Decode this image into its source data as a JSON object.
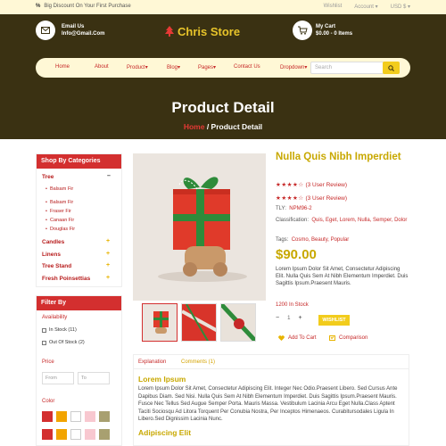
{
  "topbar": {
    "promo": "Big Discount On Your First Purchase",
    "links": [
      "Wishlist",
      "Account",
      "USD $"
    ]
  },
  "header": {
    "email_label": "Email Us",
    "email_value": "Info@Gmail.Com",
    "logo": "Chris Store",
    "cart_label": "My Cart",
    "cart_value": "$0.00 - 0 Items"
  },
  "nav": {
    "items": [
      "Home",
      "About",
      "Product",
      "Blog",
      "Pages",
      "Contact Us",
      "Dropdown"
    ],
    "dropdown_flags": [
      false,
      false,
      true,
      true,
      true,
      false,
      true
    ],
    "search_placeholder": "Search"
  },
  "hero": {
    "title": "Product Detail",
    "crumb_home": "Home",
    "crumb_sep": " / ",
    "crumb_current": "Product Detail"
  },
  "categories": {
    "title": "Shop By Categories",
    "tree": "Tree",
    "tree_toggle": "–",
    "tree_subs": [
      "Balsam Fir",
      "Balsam Fir",
      "Fraser Fir",
      "Canaan Fir",
      "Douglas Fir"
    ],
    "others": [
      "Candles",
      "Linens",
      "Tree Stand",
      "Fresh Poinsettias"
    ]
  },
  "filter": {
    "title": "Filter By",
    "availability_label": "Availability",
    "in_stock": "In Stock (11)",
    "out_of_stock": "Out Of Stock (2)",
    "price_label": "Price",
    "from_placeholder": "From",
    "to_placeholder": "To",
    "color_label": "Color",
    "colors_row1": [
      "#d32f2f",
      "#f2a400",
      "#ffffff",
      "#f8c8d0",
      "#a8a070"
    ],
    "colors_row2": [
      "#d32f2f",
      "#f2a400",
      "#ffffff",
      "#f8c8d0",
      "#a8a070"
    ]
  },
  "product": {
    "title": "Nulla Quis Nibh Imperdiet",
    "stars": "★★★★☆",
    "reviews": "(3 User Review)",
    "tly_label": "TLY:",
    "tly_value": "NPM96-2",
    "classification_label": "Classification:",
    "classification_value": "Quis, Eget, Lorem, Nulla, Semper, Dolor",
    "tags_label": "Tags:",
    "tags_value": "Cosmo, Beauty, Popular",
    "price": "$90.00",
    "description": "Lorem Ipsum Dolor Sit Amet, Consectetur Adipiscing Elit. Nulla Quis Sem At Nibh Elementum Imperdiet. Duis Sagittis Ipsum.Praesent Mauris.",
    "stock": "1200 In Stock",
    "qty_minus": "−",
    "qty_value": "1",
    "qty_plus": "+",
    "wishlist": "WISHLIST",
    "add_to_cart": "Add To Cart",
    "comparison": "Comparison"
  },
  "tabs": {
    "explanation": "Explanation",
    "comments": "Comments (1)",
    "heading1": "Lorem Ipsum",
    "para1": "Lorem Ipsum Dolor Sit Amet, Consectetur Adipiscing Elit. Integer Nec Odio.Praesent Libero. Sed Cursus Ante Dapibus Diam. Sed Nisi. Nulla Quis Sem At Nibh Elementum Imperdiet. Duis Sagittis Ipsum.Praesent Mauris. Fusce Nec Tellus Sed Augue Semper Porta. Mauris Massa. Vestibulum Lacinia Arcu Eget Nulla.Class Aptent Taciti Sociosqu Ad Litora Torquent Per Conubia Nostra, Per Inceptos Himenaeos. Curabitursodales Ligula In Libero.Sed Dignissim Lacinia Nunc.",
    "heading2": "Adipiscing Elit"
  }
}
